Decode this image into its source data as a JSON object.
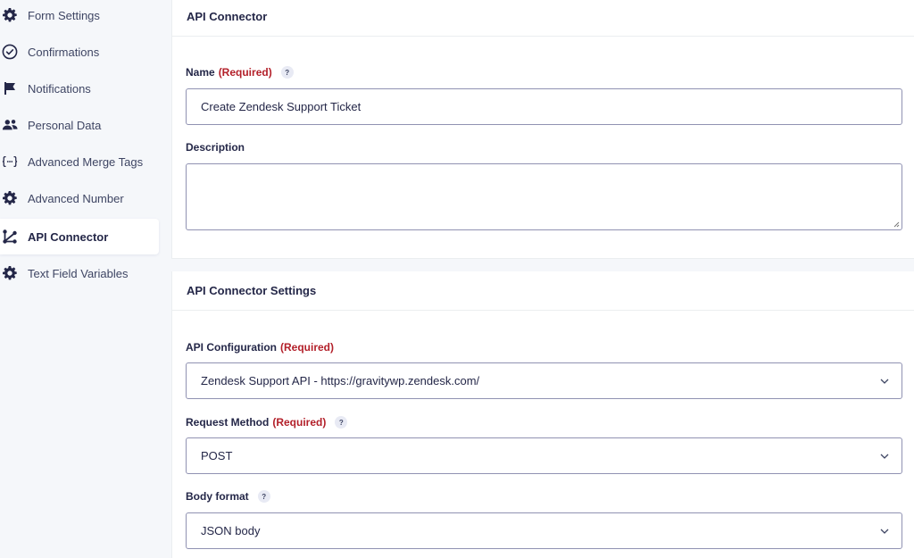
{
  "sidebar": {
    "items": [
      {
        "label": "Form Settings",
        "icon": "gear-icon"
      },
      {
        "label": "Confirmations",
        "icon": "check-circle-icon"
      },
      {
        "label": "Notifications",
        "icon": "flag-icon"
      },
      {
        "label": "Personal Data",
        "icon": "users-icon"
      },
      {
        "label": "Advanced Merge Tags",
        "icon": "merge-tags-icon"
      },
      {
        "label": "Advanced Number",
        "icon": "gear-icon"
      },
      {
        "label": "API Connector",
        "icon": "connector-icon",
        "active": true
      },
      {
        "label": "Text Field Variables",
        "icon": "gear-icon"
      }
    ]
  },
  "panel1": {
    "title": "API Connector",
    "name_label": "Name",
    "name_required": "(Required)",
    "name_help": "?",
    "name_value": "Create Zendesk Support Ticket",
    "description_label": "Description",
    "description_value": ""
  },
  "panel2": {
    "title": "API Connector Settings",
    "api_config_label": "API Configuration",
    "api_config_required": "(Required)",
    "api_config_value": "Zendesk Support API - https://gravitywp.zendesk.com/",
    "method_label": "Request Method",
    "method_required": "(Required)",
    "method_help": "?",
    "method_value": "POST",
    "body_format_label": "Body format",
    "body_format_help": "?",
    "body_format_value": "JSON body"
  },
  "colors": {
    "text": "#242748",
    "required": "#b3202a",
    "border": "#9092b2",
    "background": "#f5f7fa"
  }
}
